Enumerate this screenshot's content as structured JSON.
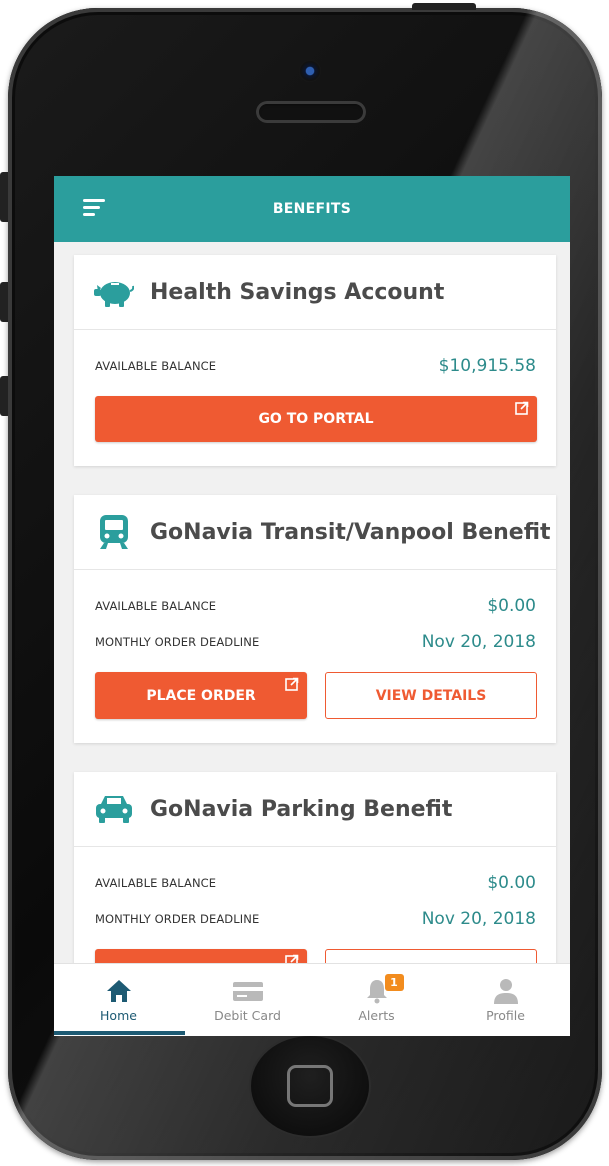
{
  "header": {
    "title": "BENEFITS"
  },
  "cards": [
    {
      "title": "Health Savings Account",
      "icon": "piggy-bank-icon",
      "rows": [
        {
          "label": "AVAILABLE BALANCE",
          "value": "$10,915.58"
        }
      ],
      "primary_button": "GO TO PORTAL"
    },
    {
      "title": "GoNavia Transit/Vanpool Benefit",
      "icon": "train-icon",
      "rows": [
        {
          "label": "AVAILABLE BALANCE",
          "value": "$0.00"
        },
        {
          "label": "MONTHLY ORDER DEADLINE",
          "value": "Nov 20, 2018"
        }
      ],
      "primary_button": "PLACE ORDER",
      "secondary_button": "VIEW DETAILS"
    },
    {
      "title": "GoNavia Parking Benefit",
      "icon": "car-icon",
      "rows": [
        {
          "label": "AVAILABLE BALANCE",
          "value": "$0.00"
        },
        {
          "label": "MONTHLY ORDER DEADLINE",
          "value": "Nov 20, 2018"
        }
      ]
    }
  ],
  "nav": [
    {
      "label": "Home",
      "icon": "home-icon",
      "active": true
    },
    {
      "label": "Debit Card",
      "icon": "credit-card-icon"
    },
    {
      "label": "Alerts",
      "icon": "bell-icon",
      "badge": "1"
    },
    {
      "label": "Profile",
      "icon": "user-icon"
    }
  ],
  "colors": {
    "header": "#2b9e9d",
    "accent": "#ef5a32",
    "value_text": "#2d8b8b",
    "nav_active": "#1d5a73",
    "badge": "#f28c1e"
  }
}
